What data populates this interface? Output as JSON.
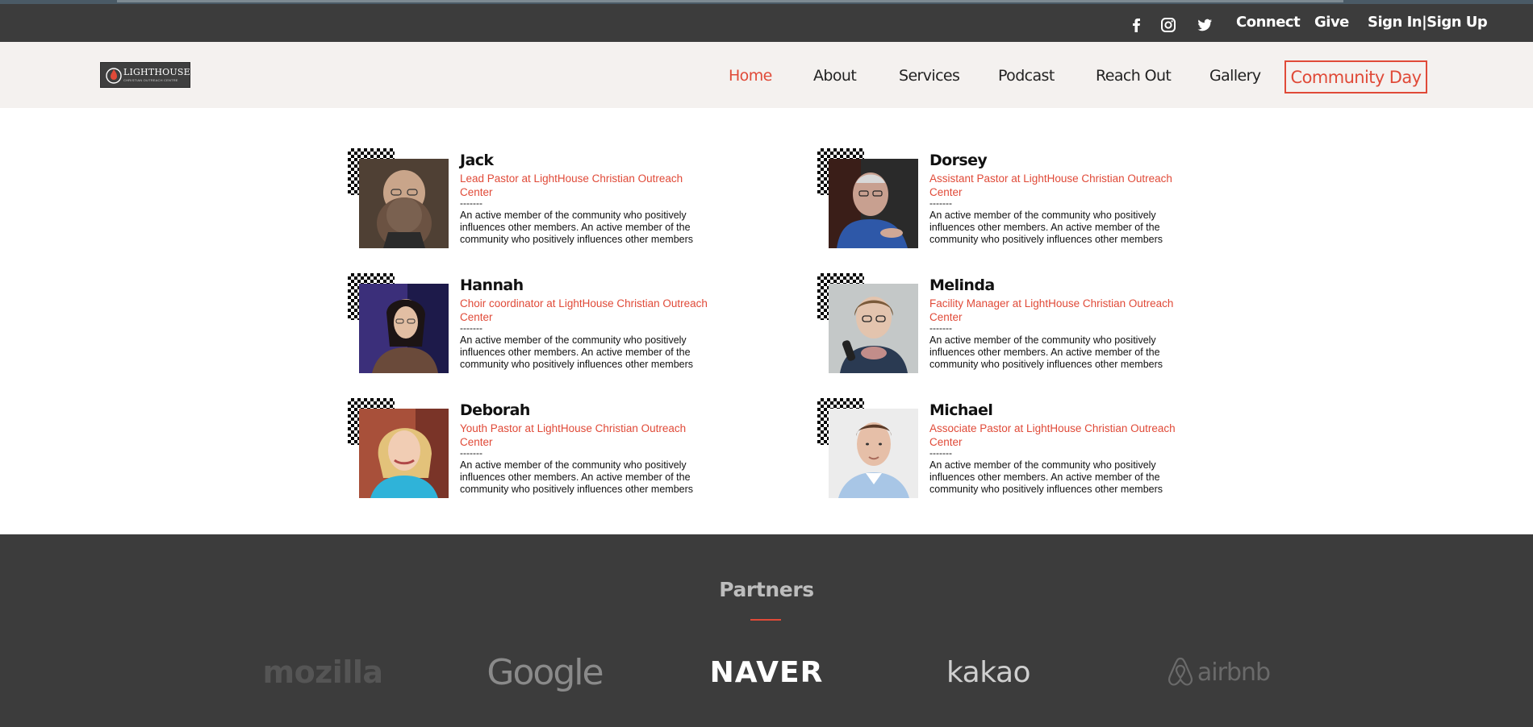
{
  "topbar": {
    "icons": [
      "facebook-icon",
      "instagram-icon",
      "twitter-icon"
    ],
    "connect": "Connect",
    "give": "Give",
    "signin": "Sign In|Sign Up"
  },
  "logo": {
    "brand": "LIGHTHOUSE",
    "sub": "CHRISTIAN OUTREACH CENTRE"
  },
  "nav": {
    "items": [
      "Home",
      "About",
      "Services",
      "Podcast",
      "Reach Out",
      "Gallery"
    ],
    "active": "Home",
    "cta": "Community Day"
  },
  "team": [
    {
      "name": "Jack",
      "role": "Lead Pastor at LightHouse Christian Outreach Center",
      "dash": "-------",
      "bio": "An active member of the community who positively influences other members. An active member of the community who positively influences other members"
    },
    {
      "name": "Dorsey",
      "role": "Assistant Pastor at LightHouse Christian Outreach Center",
      "dash": "-------",
      "bio": "An active member of the community who positively influences other members. An active member of the community who positively influences other members"
    },
    {
      "name": "Hannah",
      "role": "Choir coordinator at LightHouse Christian Outreach Center",
      "dash": "-------",
      "bio": "An active member of the community who positively influences other members. An active member of the community who positively influences other members"
    },
    {
      "name": "Melinda",
      "role": "Facility Manager at LightHouse Christian Outreach Center",
      "dash": "-------",
      "bio": "An active member of the community who positively influences other members. An active member of the community who positively influences other members"
    },
    {
      "name": "Deborah",
      "role": "Youth Pastor at LightHouse Christian Outreach Center",
      "dash": "-------",
      "bio": "An active member of the community who positively influences other members. An active member of the community who positively influences other members"
    },
    {
      "name": "Michael",
      "role": "Associate Pastor at LightHouse Christian Outreach Center",
      "dash": "-------",
      "bio": "An active member of the community who positively influences other members. An active member of the community who positively influences other members"
    }
  ],
  "partners": {
    "title": "Partners",
    "logos": [
      "mozilla",
      "Google",
      "NAVER",
      "kakao",
      "airbnb"
    ]
  },
  "colors": {
    "accent": "#e04a38",
    "topbar": "#3c3c3c",
    "navbar": "#f4f1ef"
  }
}
